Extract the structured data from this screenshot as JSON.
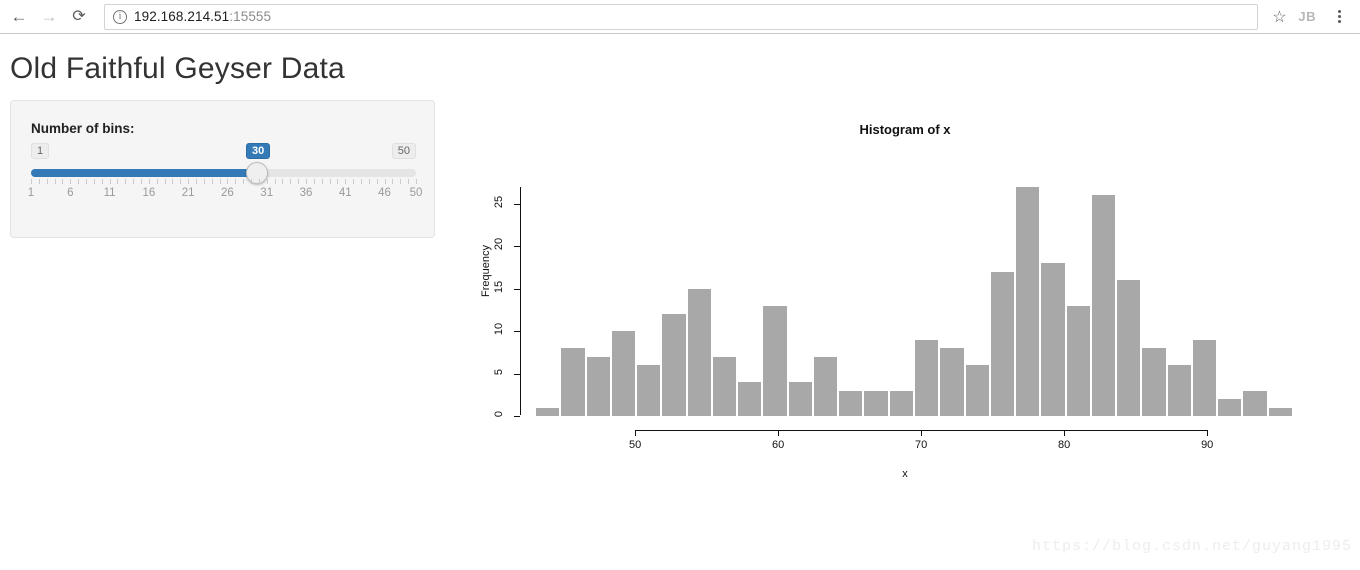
{
  "browser": {
    "back_icon": "arrow-left-icon",
    "forward_icon": "arrow-right-icon",
    "reload_icon": "reload-icon",
    "info_icon": "ⓘ",
    "url_host": "192.168.214.51",
    "url_port": ":15555",
    "bookmark_icon": "☆",
    "profile_initials": "JB",
    "menu_icon": "kebab-menu-icon"
  },
  "page": {
    "title": "Old Faithful Geyser Data",
    "watermark": "https://blog.csdn.net/guyang1995"
  },
  "slider_panel": {
    "label": "Number of bins:",
    "min_label": "1",
    "max_label": "50",
    "current_label": "30",
    "min": 1,
    "max": 50,
    "value": 30,
    "tick_labels": [
      "1",
      "6",
      "11",
      "16",
      "21",
      "26",
      "31",
      "36",
      "41",
      "46",
      "50"
    ],
    "fill_color": "#337ab7",
    "track_color": "#e5e5e5"
  },
  "chart_data": {
    "type": "bar",
    "title": "Histogram of x",
    "xlabel": "x",
    "ylabel": "Frequency",
    "grid": false,
    "legend": "none",
    "bar_color": "#a8a8a8",
    "xlim": [
      43.0,
      96.0
    ],
    "ylim": [
      0,
      27
    ],
    "xticks": [
      50,
      60,
      70,
      80,
      90
    ],
    "yticks": [
      0,
      5,
      10,
      15,
      20,
      25
    ],
    "bin_count": 30,
    "bin_width": 1.7666666666666666,
    "bin_starts": [
      43.0,
      44.77,
      46.53,
      48.3,
      50.07,
      51.83,
      53.6,
      55.37,
      57.13,
      58.9,
      60.67,
      62.43,
      64.2,
      65.97,
      67.73,
      69.5,
      71.27,
      73.03,
      74.8,
      76.57,
      78.33,
      80.1,
      81.87,
      83.63,
      85.4,
      87.17,
      88.93,
      90.7,
      92.47,
      94.23
    ],
    "categories": [
      "43.0",
      "44.8",
      "46.5",
      "48.3",
      "50.1",
      "51.8",
      "53.6",
      "55.4",
      "57.1",
      "58.9",
      "60.7",
      "62.4",
      "64.2",
      "66.0",
      "67.7",
      "69.5",
      "71.3",
      "73.0",
      "74.8",
      "76.6",
      "78.3",
      "80.1",
      "81.9",
      "83.6",
      "85.4",
      "87.2",
      "88.9",
      "90.7",
      "92.5",
      "94.2"
    ],
    "values": [
      1,
      8,
      7,
      10,
      6,
      12,
      15,
      7,
      4,
      13,
      4,
      7,
      3,
      3,
      3,
      9,
      8,
      6,
      17,
      27,
      18,
      13,
      26,
      16,
      8,
      6,
      9,
      2,
      3,
      1
    ]
  }
}
